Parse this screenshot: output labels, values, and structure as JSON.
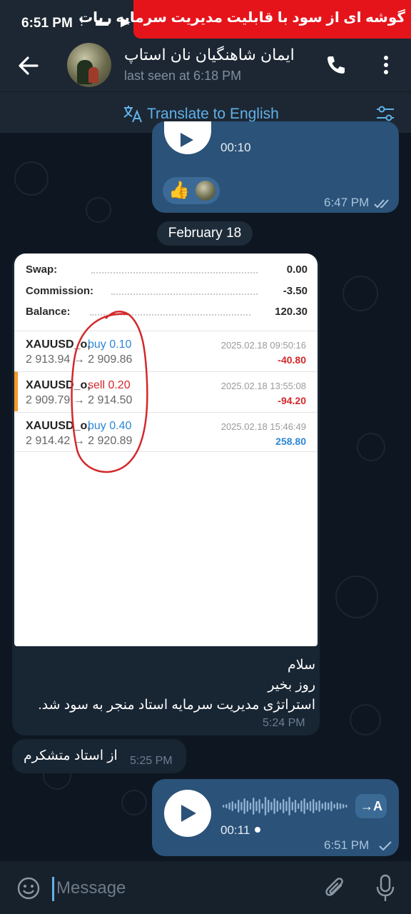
{
  "status_bar": {
    "time": "6:51 PM",
    "icons": "! ▬ ▶"
  },
  "banner": {
    "text": "گوشه ای از سود با قابلیت مدیریت سرمایه ربات"
  },
  "header": {
    "chat_name": "ایمان شاهنگیان نان استاپ",
    "last_seen": "last seen at 6:18 PM"
  },
  "translate_bar": {
    "label": "Translate to English"
  },
  "voice_top": {
    "duration": "00:10",
    "time": "6:47 PM",
    "reactions": [
      "👍",
      "avatar"
    ]
  },
  "date_separator": "February 18",
  "screenshot_card": {
    "summary": [
      {
        "label": "Swap:",
        "value": "0.00"
      },
      {
        "label": "Commission:",
        "value": "-3.50"
      },
      {
        "label": "Balance:",
        "value": "120.30"
      }
    ],
    "trades": [
      {
        "symbol": "XAUUSD_o,",
        "side": "buy 0.10",
        "type": "buy",
        "open": "2 913.94",
        "close": "2 909.86",
        "date": "2025.02.18 09:50:16",
        "profit": "-40.80",
        "profit_sign": "neg",
        "selected": false
      },
      {
        "symbol": "XAUUSD_o,",
        "side": "sell 0.20",
        "type": "sell",
        "open": "2 909.79",
        "close": "2 914.50",
        "date": "2025.02.18 13:55:08",
        "profit": "-94.20",
        "profit_sign": "neg",
        "selected": true
      },
      {
        "symbol": "XAUUSD_o,",
        "side": "buy 0.40",
        "type": "buy",
        "open": "2 914.42",
        "close": "2 920.89",
        "date": "2025.02.18 15:46:49",
        "profit": "258.80",
        "profit_sign": "pos",
        "selected": false
      }
    ]
  },
  "message1": {
    "lines": [
      "سلام",
      "روز بخیر",
      "استراتژی مدیریت سرمایه استاد منجر به سود شد."
    ],
    "time": "5:24 PM"
  },
  "message2": {
    "text": "از استاد متشکرم",
    "time": "5:25 PM"
  },
  "voice_bottom": {
    "duration": "00:11",
    "time": "6:51 PM",
    "transcribe_label": "→A"
  },
  "input": {
    "placeholder": "Message"
  },
  "colors": {
    "accent": "#5fb2ea",
    "outgoing_bubble": "#2b5278",
    "incoming_bubble": "#182533",
    "banner": "#e5141b",
    "annotation": "#d3282b"
  }
}
